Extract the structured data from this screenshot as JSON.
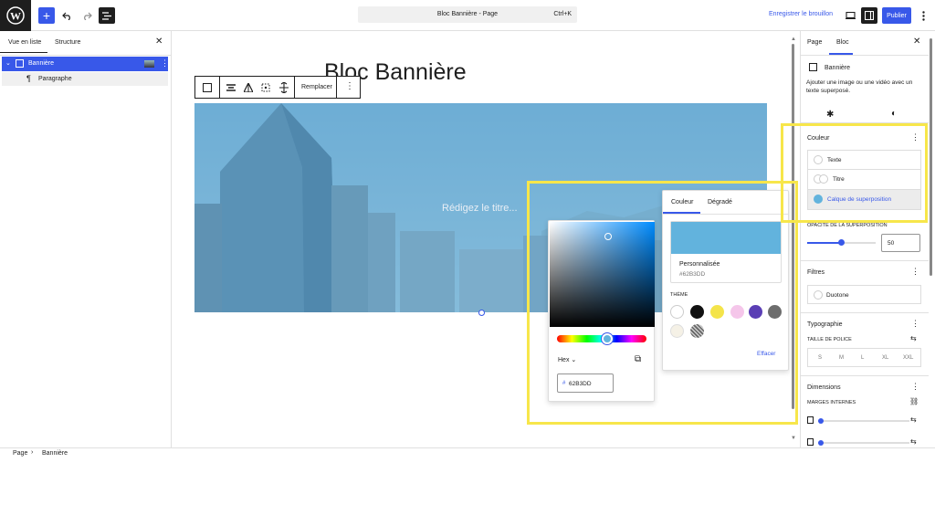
{
  "topbar": {
    "command_title": "Bloc Bannière - Page",
    "command_shortcut": "Ctrl+K",
    "save_draft": "Enregistrer le brouillon",
    "publish": "Publier"
  },
  "left_panel": {
    "tabs": [
      "Vue en liste",
      "Structure"
    ],
    "tree": [
      {
        "label": "Bannière"
      },
      {
        "label": "Paragraphe"
      }
    ]
  },
  "editor": {
    "page_title": "Bloc Bannière",
    "toolbar": {
      "replace": "Remplacer"
    },
    "cover_placeholder": "Rédigez le titre..."
  },
  "picker": {
    "format": "Hex",
    "hex_prefix": "#",
    "hex_value": "62B3DD"
  },
  "color_panel": {
    "tabs": [
      "Couleur",
      "Dégradé"
    ],
    "swatch_color": "#62b3dd",
    "custom_label": "Personnalisée",
    "custom_value": "#62B3DD",
    "theme_label": "THÈME",
    "theme_colors": [
      "#ffffff",
      "#111111",
      "#f4e44a",
      "#f5c6ea",
      "#5b3fb5",
      "#6d6d6d",
      "#f5f1e6",
      "#8a8a8a"
    ],
    "clear": "Effacer"
  },
  "sidebar": {
    "tabs": [
      "Page",
      "Bloc"
    ],
    "block_name": "Bannière",
    "block_desc": "Ajouter une image ou une vidéo avec un texte superposé.",
    "color": {
      "title": "Couleur",
      "items": [
        "Texte",
        "Titre",
        "Calque de superposition"
      ]
    },
    "opacity": {
      "label": "OPACITÉ DE LA SUPERPOSITION",
      "value": "50",
      "fraction": 0.5
    },
    "filters": {
      "title": "Filtres",
      "duotone": "Duotone"
    },
    "typography": {
      "title": "Typographie",
      "font_size_label": "TAILLE DE POLICE",
      "sizes": [
        "S",
        "M",
        "L",
        "XL",
        "XXL"
      ]
    },
    "dimensions": {
      "title": "Dimensions",
      "padding_label": "MARGES INTERNES"
    }
  },
  "footer": {
    "breadcrumb": [
      "Page",
      "Bannière"
    ]
  },
  "colors": {
    "accent": "#3858e9",
    "highlight": "#f7e64a"
  }
}
